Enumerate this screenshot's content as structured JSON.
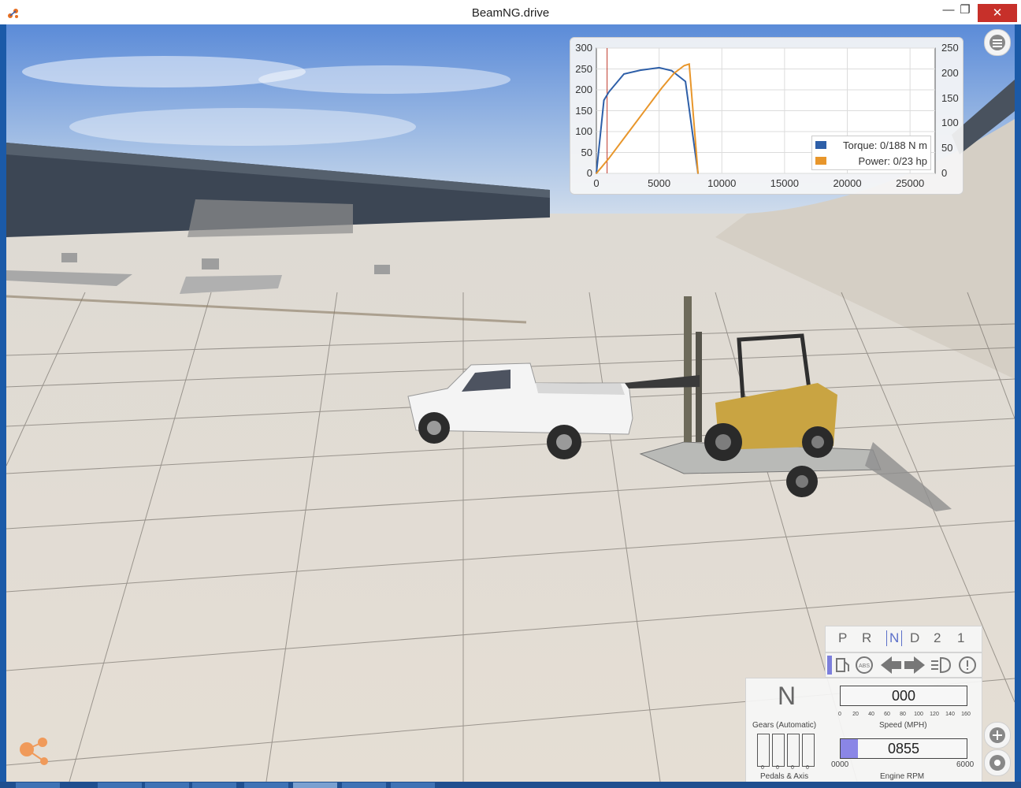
{
  "window": {
    "title": "BeamNG.drive"
  },
  "graph": {
    "left_ticks": [
      "300",
      "250",
      "200",
      "150",
      "100",
      "50",
      "0"
    ],
    "right_ticks": [
      "250",
      "200",
      "150",
      "100",
      "50",
      "0"
    ],
    "x_ticks": [
      "0",
      "5000",
      "10000",
      "15000",
      "20000",
      "25000"
    ],
    "legend": {
      "torque": "Torque: 0/188 N m",
      "power": "Power: 0/23 hp"
    }
  },
  "chart_data": {
    "type": "line",
    "x_range": [
      0,
      27000
    ],
    "y_left_range": [
      0,
      300
    ],
    "y_right_range": [
      0,
      250
    ],
    "grid": true,
    "legend_position": "bottom-right",
    "rpm_marker": 855,
    "series": [
      {
        "name": "Torque: 0/188 N m",
        "axis": "left",
        "color": "#2e5fa8",
        "x": [
          0,
          600,
          1000,
          2200,
          3500,
          5000,
          6000,
          7100,
          8100
        ],
        "y": [
          0,
          175,
          195,
          238,
          247,
          253,
          246,
          220,
          0
        ]
      },
      {
        "name": "Power: 0/23 hp",
        "axis": "right",
        "color": "#e8962b",
        "x": [
          0,
          1000,
          2500,
          4000,
          5200,
          6200,
          7000,
          7400,
          8100
        ],
        "y": [
          0,
          30,
          80,
          130,
          170,
          200,
          215,
          218,
          0
        ]
      }
    ]
  },
  "dashboard": {
    "gears": [
      "P",
      "R",
      "N",
      "D",
      "2",
      "1"
    ],
    "current_gear": "N",
    "gears_label": "Gears (Automatic)",
    "speed_value": "000",
    "speed_label": "Speed (MPH)",
    "speed_ticks": [
      "0",
      "20",
      "40",
      "60",
      "80",
      "100",
      "120",
      "140",
      "160"
    ],
    "rpm_value": "0855",
    "rpm_min": "0000",
    "rpm_max": "6000",
    "rpm_label": "Engine RPM",
    "pedals_label": "Pedals & Axis",
    "pedal_values": [
      "0",
      "0",
      "0",
      "0"
    ],
    "abs_label": "ABS",
    "rpm_fill_fraction": 0.14
  }
}
